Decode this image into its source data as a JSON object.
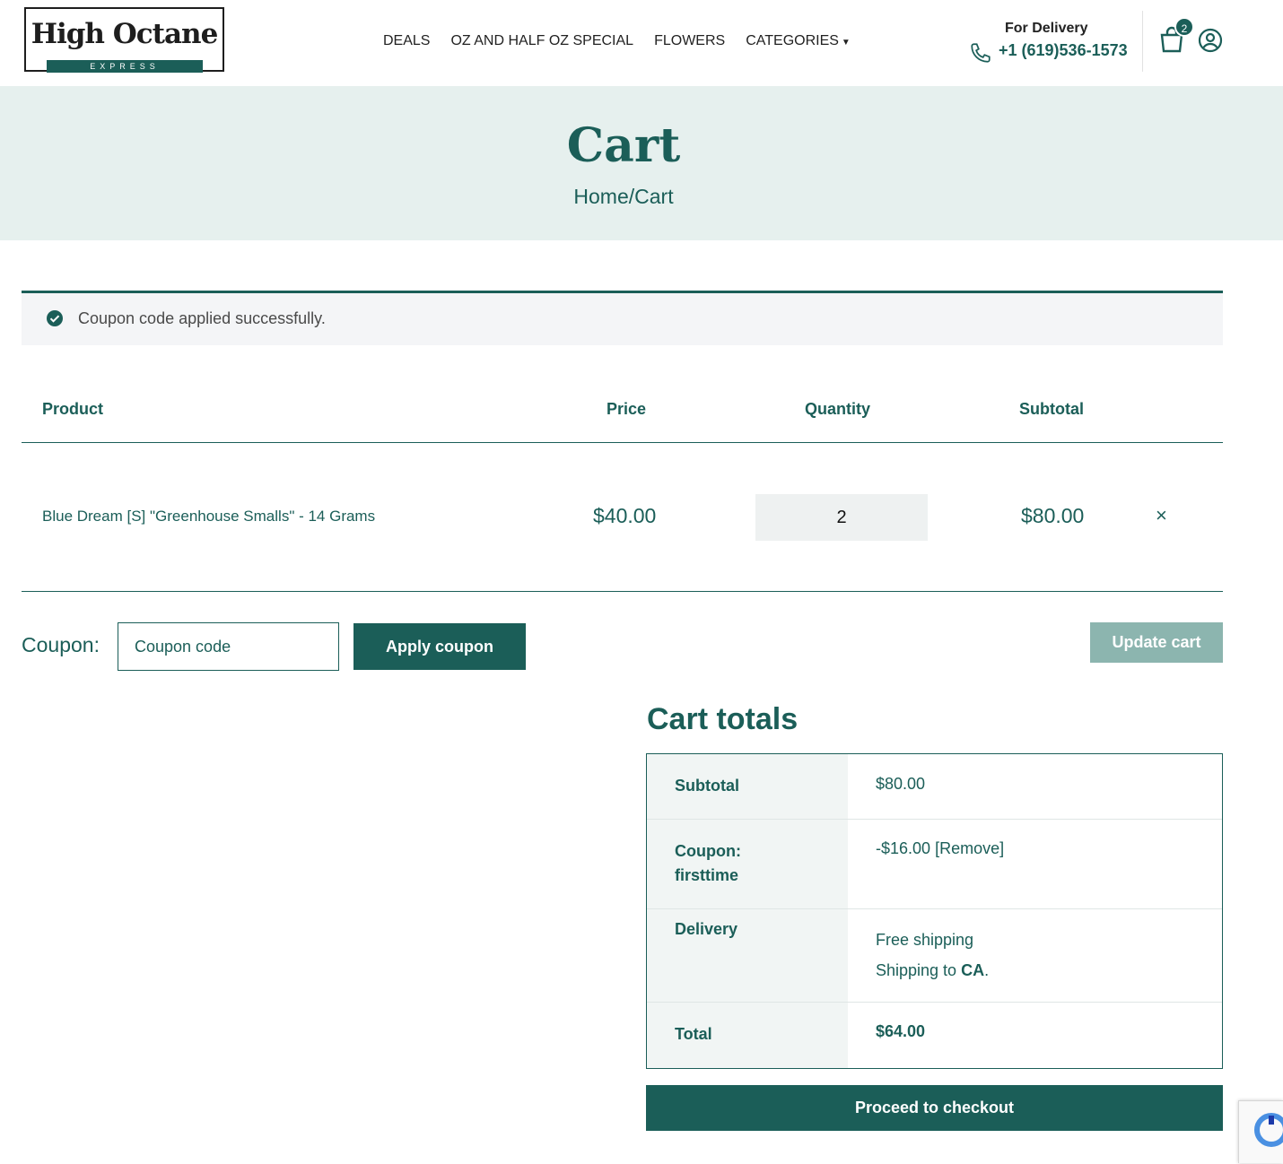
{
  "brand": {
    "title": "High Octane",
    "subtitle": "EXPRESS"
  },
  "nav": {
    "items": [
      "DEALS",
      "OZ AND HALF OZ SPECIAL",
      "FLOWERS",
      "CATEGORIES"
    ]
  },
  "delivery": {
    "label": "For Delivery",
    "phone": "+1 (619)536-1573"
  },
  "cart_count": "2",
  "hero": {
    "title": "Cart",
    "breadcrumb": "Home/Cart"
  },
  "notice": {
    "text": "Coupon code applied successfully."
  },
  "table": {
    "headers": {
      "product": "Product",
      "price": "Price",
      "quantity": "Quantity",
      "subtotal": "Subtotal"
    },
    "rows": [
      {
        "product": "Blue Dream [S] \"Greenhouse Smalls\" - 14 Grams",
        "price": "$40.00",
        "quantity": "2",
        "subtotal": "$80.00",
        "remove": "×"
      }
    ]
  },
  "coupon": {
    "label": "Coupon:",
    "placeholder": "Coupon code",
    "apply_label": "Apply coupon",
    "update_label": "Update cart"
  },
  "totals": {
    "title": "Cart totals",
    "subtotal_label": "Subtotal",
    "subtotal_value": "$80.00",
    "coupon_label_1": "Coupon:",
    "coupon_label_2": "firsttime",
    "coupon_value": "-$16.00",
    "coupon_remove": "[Remove]",
    "delivery_label": "Delivery",
    "delivery_value": "Free shipping",
    "shipping_prefix": "Shipping to",
    "shipping_region": "CA",
    "shipping_suffix": ".",
    "total_label": "Total",
    "total_value": "$64.00"
  },
  "checkout_label": "Proceed to checkout",
  "colors": {
    "primary": "#1b5e58",
    "hero_bg": "#e6f0ee",
    "update_disabled": "#8cb5af"
  }
}
